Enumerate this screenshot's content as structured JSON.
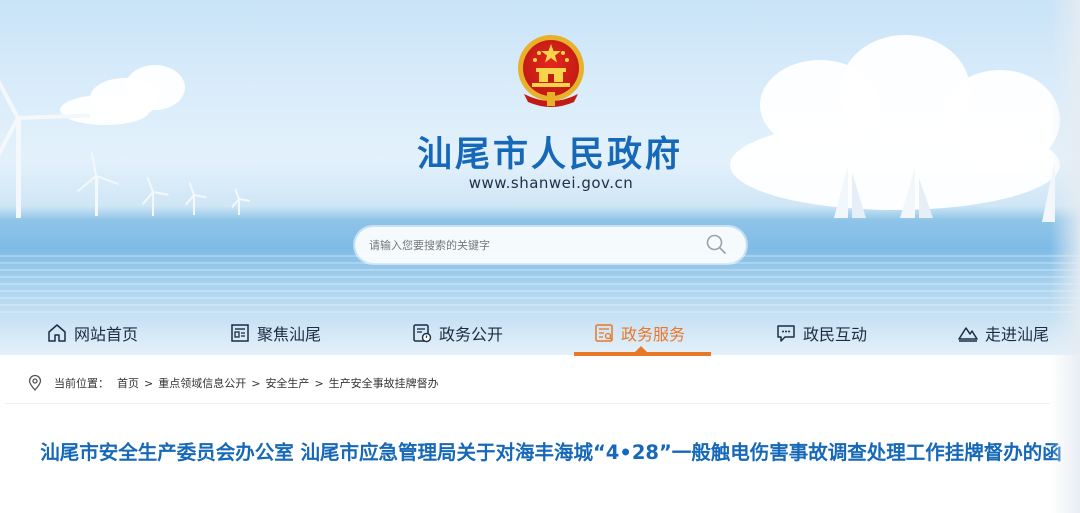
{
  "site": {
    "title": "汕尾市人民政府",
    "url": "www.shanwei.gov.cn"
  },
  "search": {
    "placeholder": "请输入您要搜索的关键字"
  },
  "nav": {
    "items": [
      {
        "label": "网站首页",
        "icon": "home-icon"
      },
      {
        "label": "聚焦汕尾",
        "icon": "newspaper-icon"
      },
      {
        "label": "政务公开",
        "icon": "document-icon"
      },
      {
        "label": "政务服务",
        "icon": "service-icon",
        "active": true
      },
      {
        "label": "政民互动",
        "icon": "chat-icon"
      },
      {
        "label": "走进汕尾",
        "icon": "mountain-icon"
      }
    ]
  },
  "breadcrumb": {
    "label": "当前位置：",
    "items": [
      "首页",
      "重点领域信息公开",
      "安全生产",
      "生产安全事故挂牌督办"
    ],
    "separator": ">"
  },
  "article": {
    "title": "汕尾市安全生产委员会办公室 汕尾市应急管理局关于对海丰海城“4•28”一般触电伤害事故调查处理工作挂牌督办的函"
  },
  "colors": {
    "brand_blue": "#1668b8",
    "accent_orange": "#e7782a",
    "text_dark": "#1d2c44"
  }
}
